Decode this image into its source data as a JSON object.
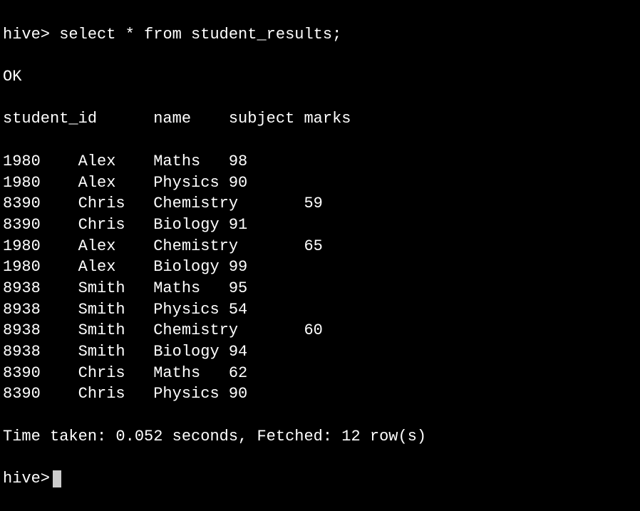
{
  "prompt": "hive>",
  "query": "select * from student_results;",
  "status": "OK",
  "header_line": "student_id      name    subject marks",
  "chart_data": {
    "type": "table",
    "columns": [
      "student_id",
      "name",
      "subject",
      "marks"
    ],
    "rows": [
      {
        "student_id": 1980,
        "name": "Alex",
        "subject": "Maths",
        "marks": 98
      },
      {
        "student_id": 1980,
        "name": "Alex",
        "subject": "Physics",
        "marks": 90
      },
      {
        "student_id": 8390,
        "name": "Chris",
        "subject": "Chemistry",
        "marks": 59
      },
      {
        "student_id": 8390,
        "name": "Chris",
        "subject": "Biology",
        "marks": 91
      },
      {
        "student_id": 1980,
        "name": "Alex",
        "subject": "Chemistry",
        "marks": 65
      },
      {
        "student_id": 1980,
        "name": "Alex",
        "subject": "Biology",
        "marks": 99
      },
      {
        "student_id": 8938,
        "name": "Smith",
        "subject": "Maths",
        "marks": 95
      },
      {
        "student_id": 8938,
        "name": "Smith",
        "subject": "Physics",
        "marks": 54
      },
      {
        "student_id": 8938,
        "name": "Smith",
        "subject": "Chemistry",
        "marks": 60
      },
      {
        "student_id": 8938,
        "name": "Smith",
        "subject": "Biology",
        "marks": 94
      },
      {
        "student_id": 8390,
        "name": "Chris",
        "subject": "Maths",
        "marks": 62
      },
      {
        "student_id": 8390,
        "name": "Chris",
        "subject": "Physics",
        "marks": 90
      }
    ]
  },
  "footer": "Time taken: 0.052 seconds, Fetched: 12 row(s)"
}
